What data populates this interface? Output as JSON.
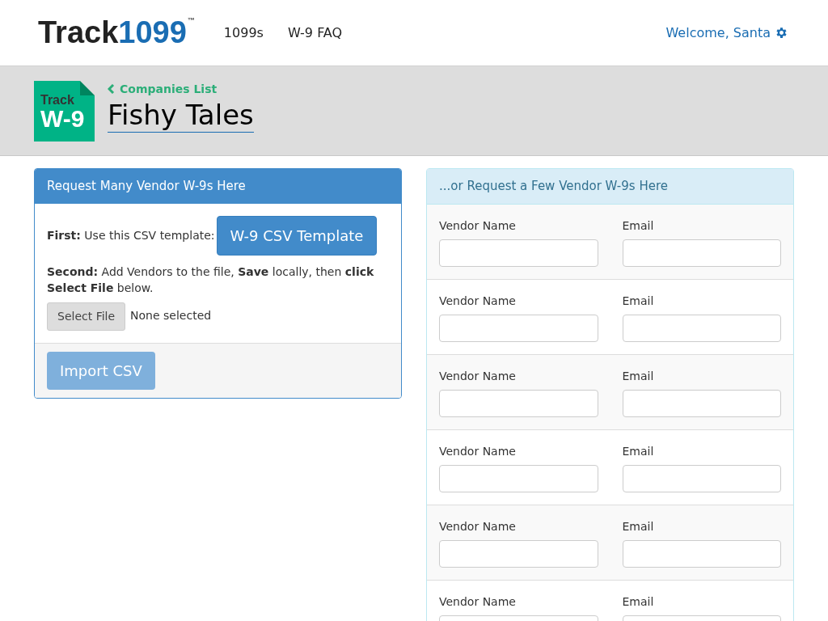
{
  "header": {
    "logo": {
      "word": "Track",
      "number": "1099",
      "mark": "™"
    },
    "nav": [
      "1099s",
      "W-9 FAQ"
    ],
    "welcome": "Welcome, Santa"
  },
  "company": {
    "badge": {
      "top": "Track",
      "main": "W-9"
    },
    "back_link": "Companies List",
    "title": "Fishy Tales"
  },
  "bulk_panel": {
    "title": "Request Many Vendor W-9s Here",
    "first": "**First:** Use this CSV template:",
    "template_button": "W-9 CSV Template",
    "second": "**Second:** Add Vendors to the file, **Save** locally, then **click Select File** below.",
    "file_button": "Select File",
    "file_status": "None selected",
    "import_button": {
      "label": "Import CSV",
      "disabled": true
    }
  },
  "few_panel": {
    "title": "...or Request a Few Vendor W-9s Here",
    "rows": [
      {
        "name_label": "Vendor Name",
        "email_label": "Email"
      },
      {
        "name_label": "Vendor Name",
        "email_label": "Email"
      },
      {
        "name_label": "Vendor Name",
        "email_label": "Email"
      },
      {
        "name_label": "Vendor Name",
        "email_label": "Email"
      },
      {
        "name_label": "Vendor Name",
        "email_label": "Email"
      },
      {
        "name_label": "Vendor Name",
        "email_label": "Email"
      }
    ]
  }
}
